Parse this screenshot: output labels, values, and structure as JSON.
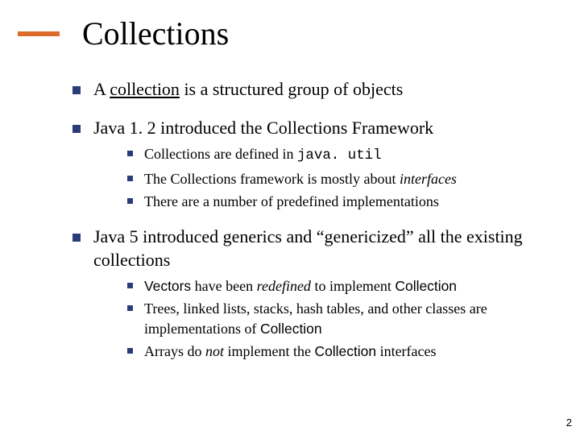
{
  "title": "Collections",
  "bullets": {
    "b1": {
      "pre": "A ",
      "u": "collection",
      "post": " is a structured group of objects"
    },
    "b2": "Java 1. 2 introduced the Collections Framework",
    "b2_sub": {
      "s1_pre": "Collections are defined in ",
      "s1_code": "java. util",
      "s2_pre": "The Collections framework is mostly about ",
      "s2_it": "interfaces",
      "s3": "There are a number of predefined implementations"
    },
    "b3": "Java 5 introduced generics and “genericized” all the existing collections",
    "b3_sub": {
      "s1_sans1": "Vectors",
      "s1_mid1": " have been ",
      "s1_it": "redefined",
      "s1_mid2": " to implement ",
      "s1_sans2": "Collection",
      "s2_pre": "Trees, linked lists, stacks, hash tables, and other classes are implementations of ",
      "s2_sans": "Collection",
      "s3_pre": "Arrays do ",
      "s3_it": "not",
      "s3_mid": " implement the ",
      "s3_sans": "Collection",
      "s3_post": " interfaces"
    }
  },
  "page_number": "2"
}
